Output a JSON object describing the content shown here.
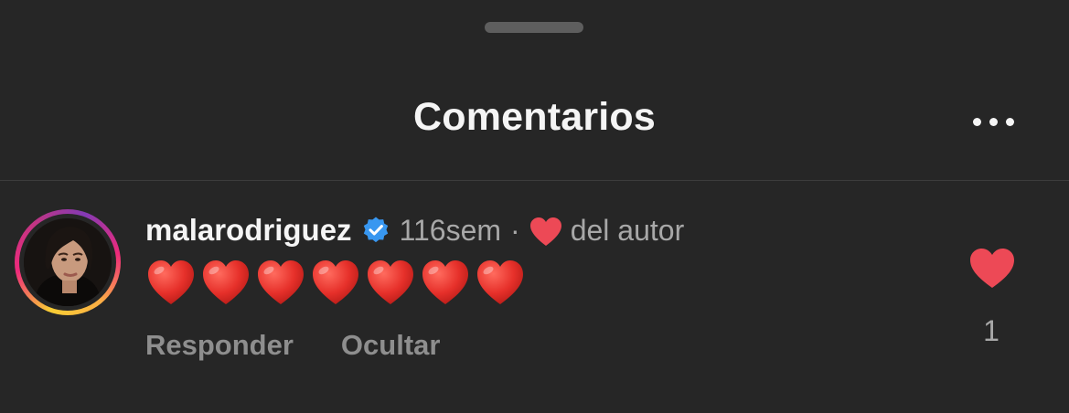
{
  "sheet": {
    "title": "Comentarios",
    "more_icon": "more-horizontal-icon"
  },
  "comment": {
    "username": "malarodriguez",
    "verified_icon": "verified-badge-icon",
    "timestamp": "116sem",
    "separator": "·",
    "author_like_text": "del autor",
    "author_like_icon": "heart-icon",
    "text_emoji": [
      "❤️",
      "❤️",
      "❤️",
      "❤️",
      "❤️",
      "❤️",
      "❤️"
    ],
    "actions": {
      "reply": "Responder",
      "hide": "Ocultar"
    },
    "like_icon": "heart-filled-icon",
    "like_count": "1"
  },
  "colors": {
    "background": "#262626",
    "like_red": "#ed4956",
    "verified_blue": "#3897f0",
    "muted_text": "#a8a8a8",
    "action_text": "#8e8e8e"
  }
}
